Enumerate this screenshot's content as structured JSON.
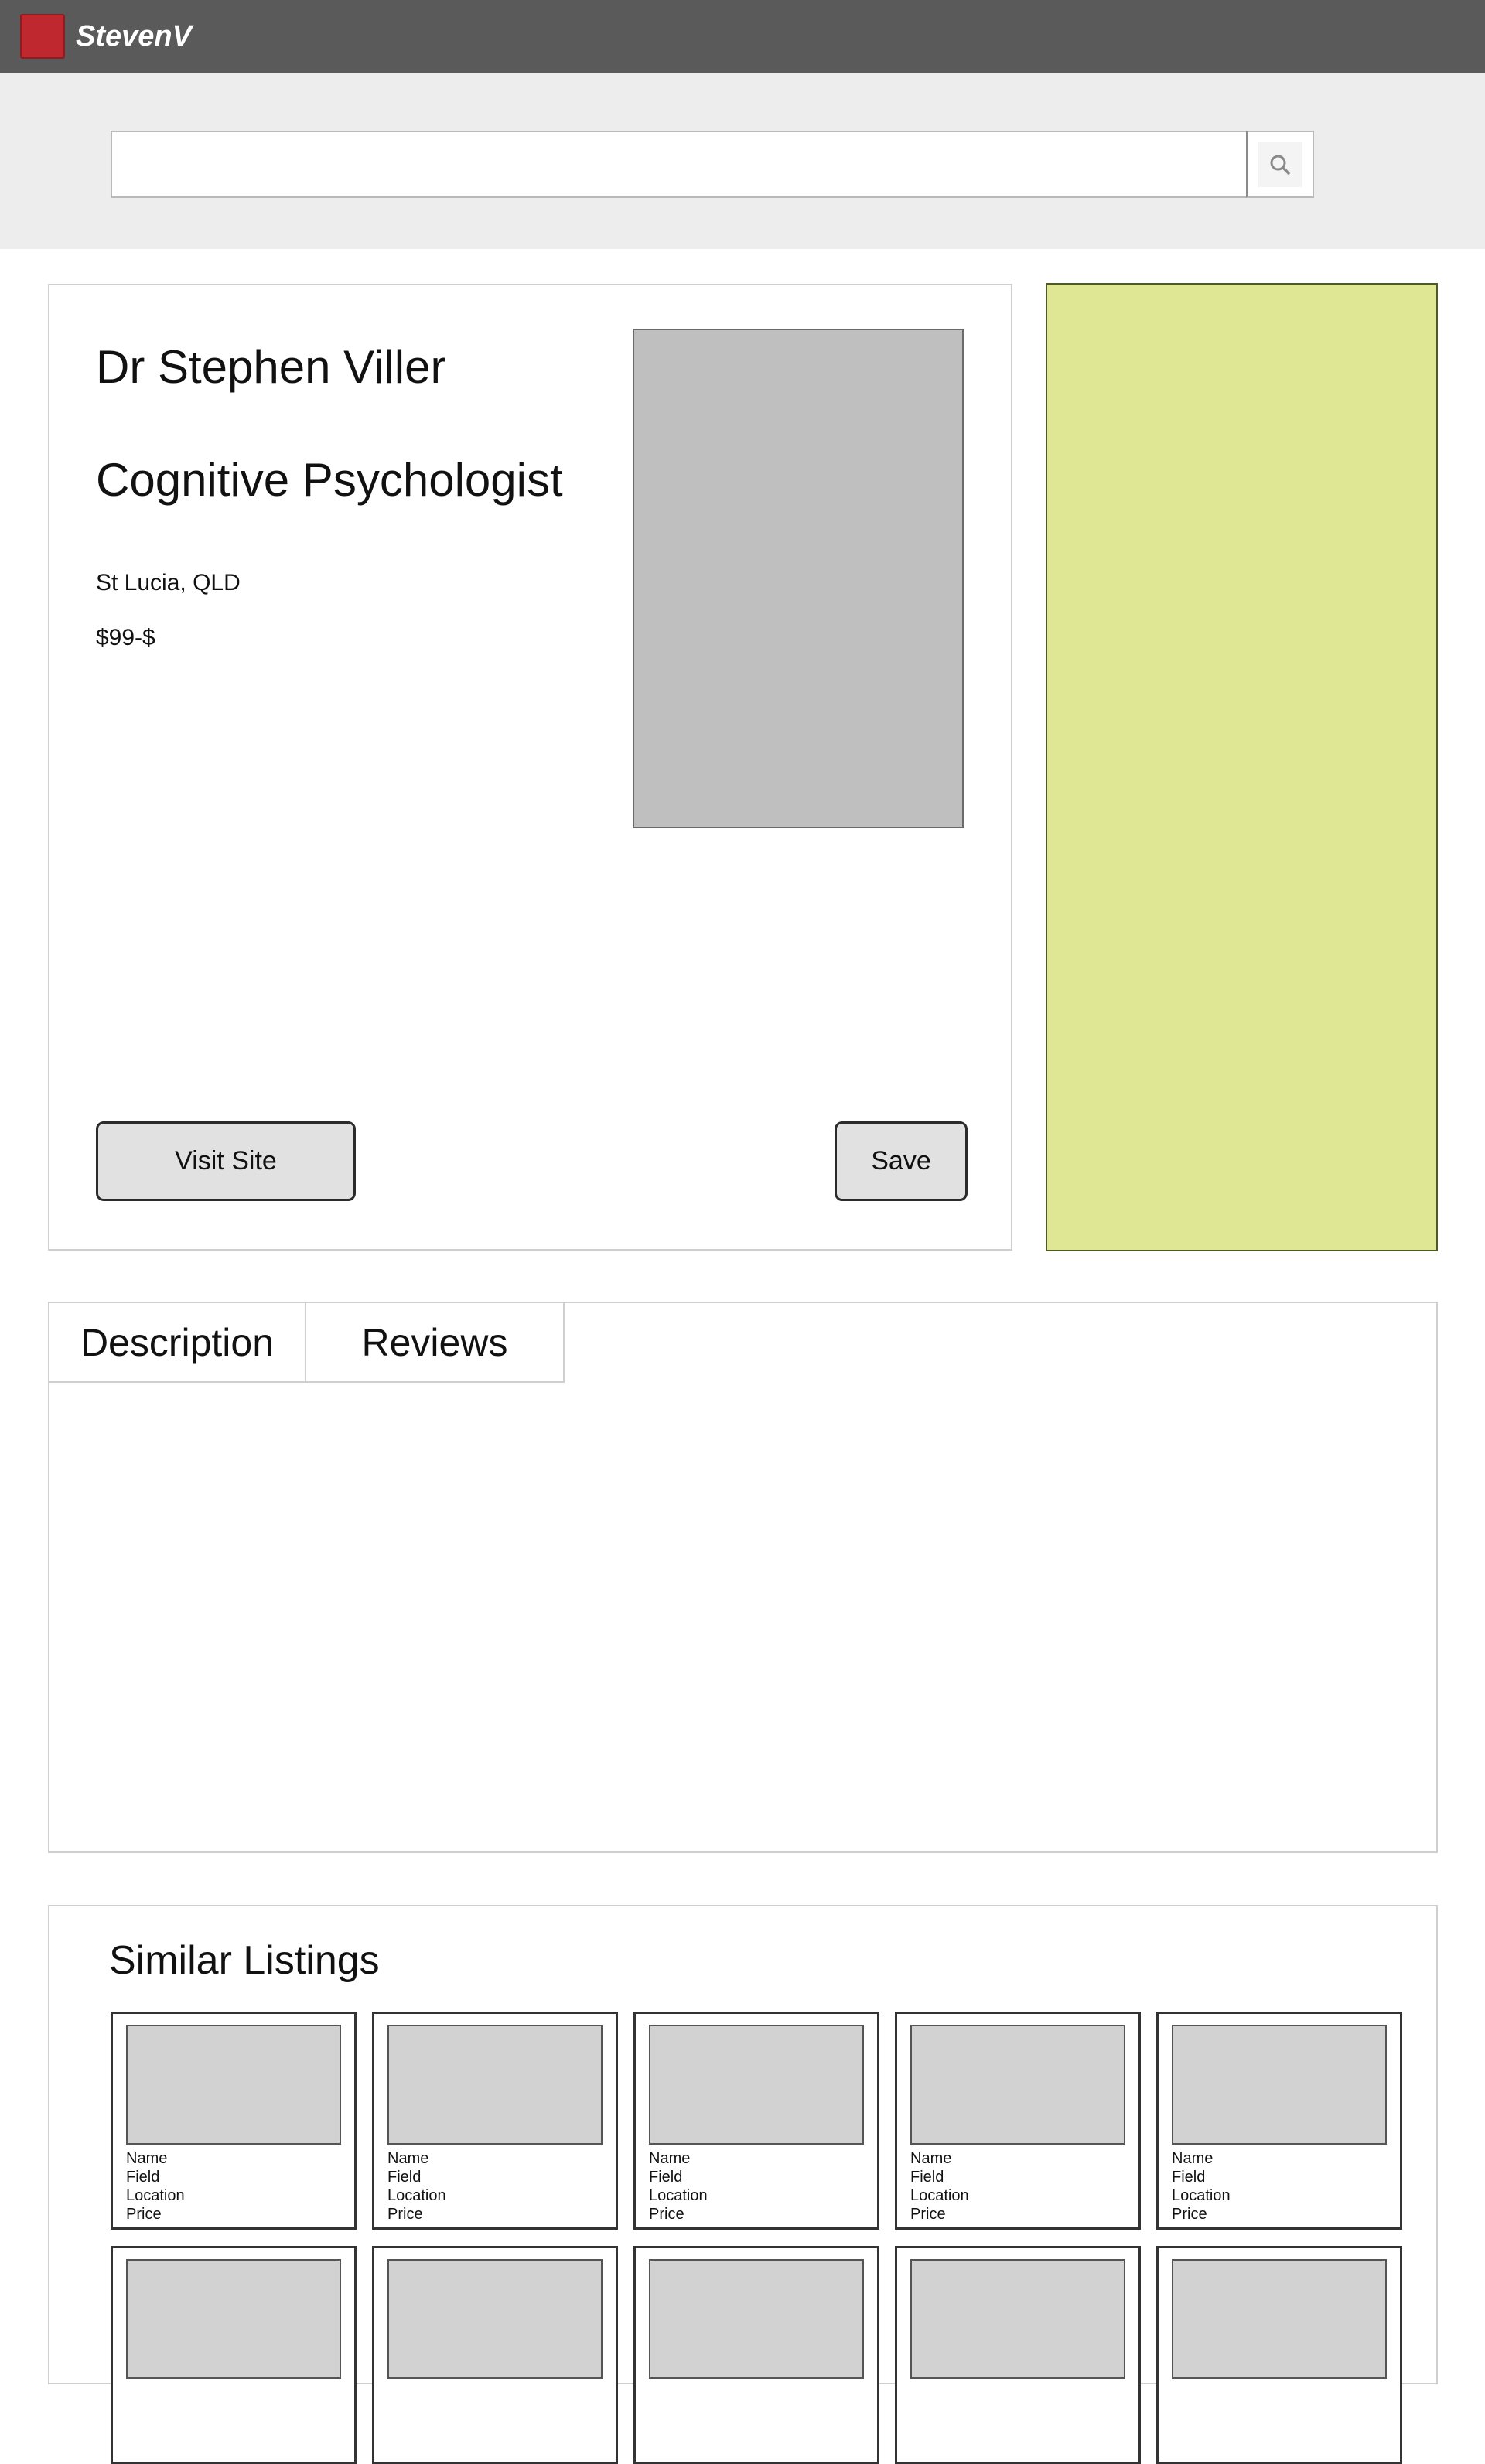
{
  "header": {
    "brand": "StevenV",
    "brand_color": "#c0282f",
    "bar_color": "#5a5a5a"
  },
  "search": {
    "value": "",
    "placeholder": "",
    "icon": "search-icon"
  },
  "profile": {
    "name": "Dr Stephen Viller",
    "title": "Cognitive Psychologist",
    "location": "St Lucia, QLD",
    "price": "$99-$",
    "visit_label": "Visit Site",
    "save_label": "Save"
  },
  "ad": {
    "color": "#dfe694"
  },
  "tabs": [
    {
      "label": "Description"
    },
    {
      "label": "Reviews"
    }
  ],
  "similar": {
    "title": "Similar Listings",
    "card": {
      "name": "Name",
      "field": "Field",
      "location": "Location",
      "price": "Price"
    }
  }
}
